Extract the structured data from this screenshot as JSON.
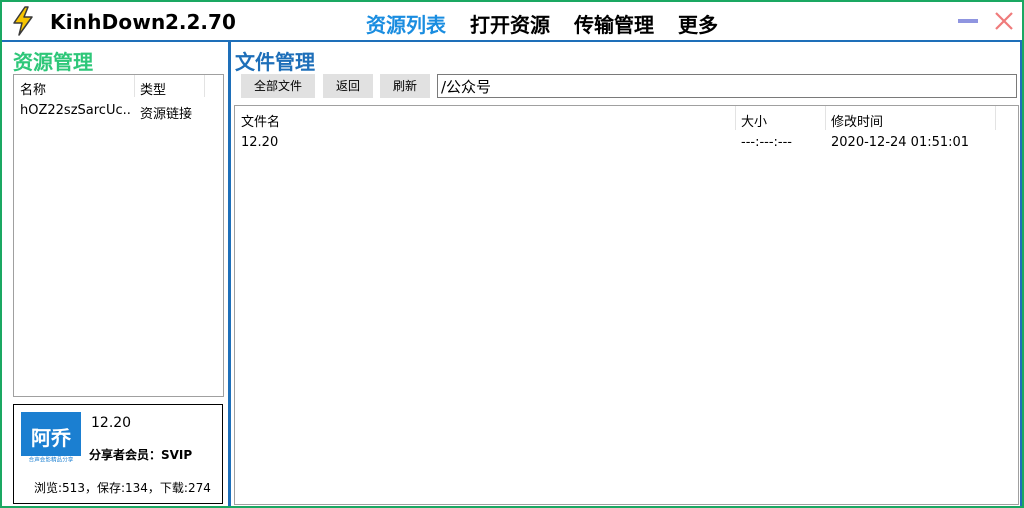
{
  "app": {
    "name": "KinhDown",
    "version": "2.2.70"
  },
  "nav": [
    {
      "label": "资源列表",
      "active": true
    },
    {
      "label": "打开资源",
      "active": false
    },
    {
      "label": "传输管理",
      "active": false
    },
    {
      "label": "更多",
      "active": false
    }
  ],
  "window_controls": {
    "minimize_icon": "minimize-icon",
    "close_icon": "close-icon"
  },
  "resource_panel": {
    "title": "资源管理",
    "columns": [
      "名称",
      "类型"
    ],
    "rows": [
      {
        "name": "hOZ22szSarcUc...",
        "type": "资源链接"
      }
    ]
  },
  "share_info": {
    "avatar_text": "阿乔",
    "avatar_subtext": "合声会影精品分享",
    "name": "12.20",
    "member": "分享者会员：SVIP",
    "stats": "浏览:513，保存:134，下载:274"
  },
  "file_panel": {
    "title": "文件管理",
    "buttons": {
      "all_files": "全部文件",
      "back": "返回",
      "refresh": "刷新"
    },
    "path": "/公众号",
    "columns": [
      "文件名",
      "大小",
      "修改时间"
    ],
    "rows": [
      {
        "name": "12.20",
        "size": "---:---:---",
        "modified": "2020-12-24 01:51:01"
      }
    ]
  },
  "colors": {
    "accent_blue": "#1e6fb9",
    "nav_active": "#1a8de0",
    "green": "#2ec779",
    "frame_green": "#1aa862"
  }
}
